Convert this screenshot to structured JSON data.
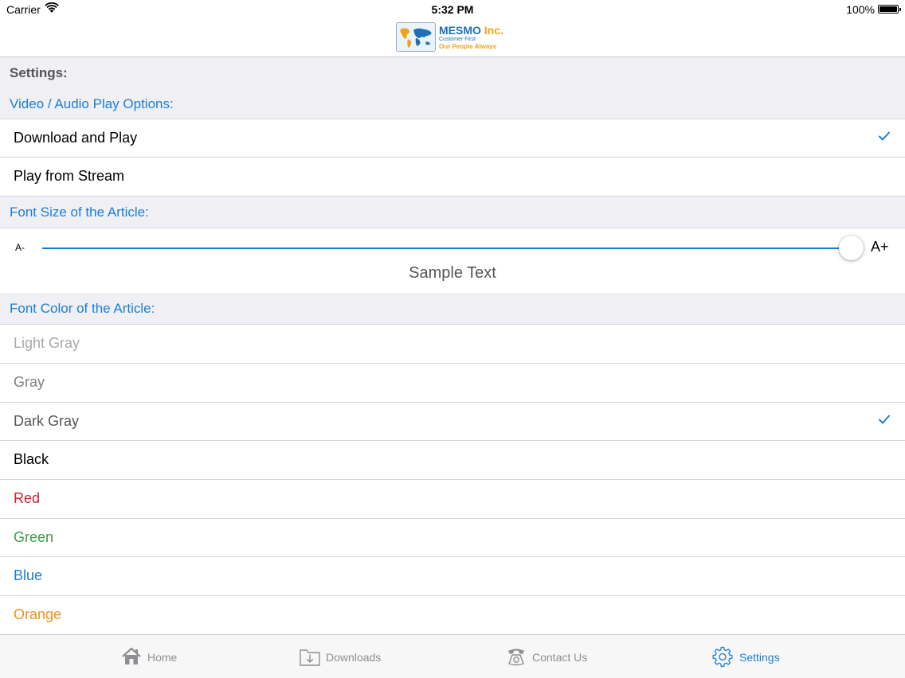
{
  "status_bar": {
    "carrier": "Carrier",
    "time": "5:32 PM",
    "battery": "100%"
  },
  "logo": {
    "brand": "MESMO",
    "brand_suffix": "Inc.",
    "tagline1": "Customer First",
    "tagline2": "Our People Always"
  },
  "settings": {
    "title": "Settings:",
    "play_options": {
      "header": "Video / Audio Play Options:",
      "items": [
        {
          "label": "Download and Play",
          "selected": true
        },
        {
          "label": "Play from Stream",
          "selected": false
        }
      ]
    },
    "font_size": {
      "header": "Font Size of the Article:",
      "min_label": "A-",
      "max_label": "A+",
      "slider_value_fraction": 1.0,
      "sample_text": "Sample Text"
    },
    "font_color": {
      "header": "Font Color of the Article:",
      "items": [
        {
          "label": "Light Gray",
          "color": "#a9a9ae",
          "selected": false
        },
        {
          "label": "Gray",
          "color": "#808085",
          "selected": false
        },
        {
          "label": "Dark Gray",
          "color": "#555555",
          "selected": true
        },
        {
          "label": "Black",
          "color": "#000000",
          "selected": false
        },
        {
          "label": "Red",
          "color": "#d21f2b",
          "selected": false
        },
        {
          "label": "Green",
          "color": "#3e9a4b",
          "selected": false
        },
        {
          "label": "Blue",
          "color": "#1a7fd4",
          "selected": false
        },
        {
          "label": "Orange",
          "color": "#f0901e",
          "selected": false
        }
      ]
    }
  },
  "tab_bar": {
    "tabs": [
      {
        "label": "Home",
        "icon": "home-icon",
        "active": false
      },
      {
        "label": "Downloads",
        "icon": "downloads-icon",
        "active": false
      },
      {
        "label": "Contact Us",
        "icon": "phone-icon",
        "active": false
      },
      {
        "label": "Settings",
        "icon": "gear-icon",
        "active": true
      }
    ]
  },
  "colors": {
    "accent": "#1a7fd4",
    "section_bg": "#efeff4",
    "tab_inactive": "#8e8e93"
  }
}
